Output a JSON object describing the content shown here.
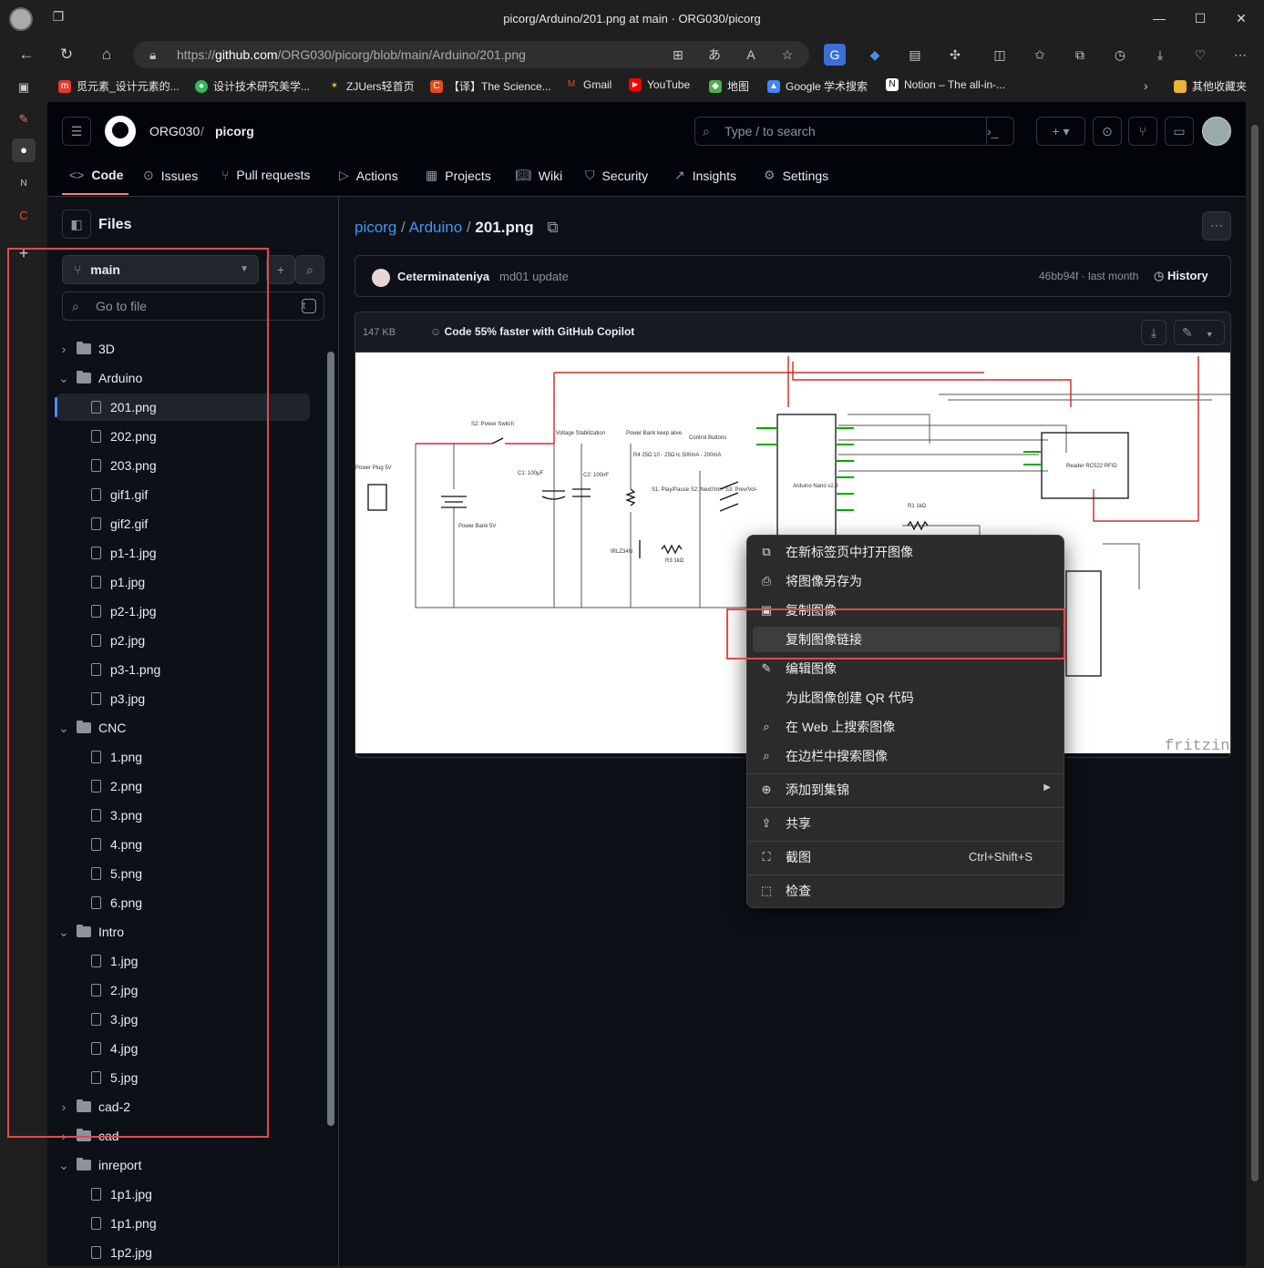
{
  "browser": {
    "window_title": "picorg/Arduino/201.png at main · ORG030/picorg",
    "url_prefix": "https://",
    "url_host": "github.com",
    "url_path": "/ORG030/picorg/blob/main/Arduino/201.png",
    "bookmarks": [
      "觅元素_设计元素的...",
      "设计技术研究美学...",
      "ZJUers轻首页",
      "【译】The Science...",
      "Gmail",
      "YouTube",
      "地图",
      "Google 学术搜索",
      "Notion – The all-in-...",
      "其他收藏夹"
    ]
  },
  "github": {
    "owner": "ORG030",
    "repo": "picorg",
    "search_placeholder": "Type / to search",
    "tabs": [
      "Code",
      "Issues",
      "Pull requests",
      "Actions",
      "Projects",
      "Wiki",
      "Security",
      "Insights",
      "Settings"
    ]
  },
  "files_panel": {
    "title": "Files",
    "branch": "main",
    "goto_placeholder": "Go to file",
    "goto_shortcut": "t",
    "tree": [
      {
        "name": "3D",
        "type": "folder",
        "open": false,
        "depth": 0
      },
      {
        "name": "Arduino",
        "type": "folder",
        "open": true,
        "depth": 0
      },
      {
        "name": "201.png",
        "type": "file",
        "depth": 1,
        "selected": true
      },
      {
        "name": "202.png",
        "type": "file",
        "depth": 1
      },
      {
        "name": "203.png",
        "type": "file",
        "depth": 1
      },
      {
        "name": "gif1.gif",
        "type": "file",
        "depth": 1
      },
      {
        "name": "gif2.gif",
        "type": "file",
        "depth": 1
      },
      {
        "name": "p1-1.jpg",
        "type": "file",
        "depth": 1
      },
      {
        "name": "p1.jpg",
        "type": "file",
        "depth": 1
      },
      {
        "name": "p2-1.jpg",
        "type": "file",
        "depth": 1
      },
      {
        "name": "p2.jpg",
        "type": "file",
        "depth": 1
      },
      {
        "name": "p3-1.png",
        "type": "file",
        "depth": 1
      },
      {
        "name": "p3.jpg",
        "type": "file",
        "depth": 1
      },
      {
        "name": "CNC",
        "type": "folder",
        "open": true,
        "depth": 0
      },
      {
        "name": "1.png",
        "type": "file",
        "depth": 1
      },
      {
        "name": "2.png",
        "type": "file",
        "depth": 1
      },
      {
        "name": "3.png",
        "type": "file",
        "depth": 1
      },
      {
        "name": "4.png",
        "type": "file",
        "depth": 1
      },
      {
        "name": "5.png",
        "type": "file",
        "depth": 1
      },
      {
        "name": "6.png",
        "type": "file",
        "depth": 1
      },
      {
        "name": "Intro",
        "type": "folder",
        "open": true,
        "depth": 0
      },
      {
        "name": "1.jpg",
        "type": "file",
        "depth": 1
      },
      {
        "name": "2.jpg",
        "type": "file",
        "depth": 1
      },
      {
        "name": "3.jpg",
        "type": "file",
        "depth": 1
      },
      {
        "name": "4.jpg",
        "type": "file",
        "depth": 1
      },
      {
        "name": "5.jpg",
        "type": "file",
        "depth": 1
      },
      {
        "name": "cad-2",
        "type": "folder",
        "open": false,
        "depth": 0
      },
      {
        "name": "cad",
        "type": "folder",
        "open": false,
        "depth": 0
      },
      {
        "name": "inreport",
        "type": "folder",
        "open": true,
        "depth": 0
      },
      {
        "name": "1p1.jpg",
        "type": "file",
        "depth": 1
      },
      {
        "name": "1p1.png",
        "type": "file",
        "depth": 1
      },
      {
        "name": "1p2.jpg",
        "type": "file",
        "depth": 1
      }
    ]
  },
  "file_view": {
    "breadcrumb_repo": "picorg",
    "breadcrumb_dir": "Arduino",
    "breadcrumb_file": "201.png",
    "commit_author": "Ceterminateniya",
    "commit_message": "md01 update",
    "commit_meta": "46bb94f · last month",
    "history_label": "History",
    "file_size": "147 KB",
    "copilot_text": "Code 55% faster with GitHub Copilot"
  },
  "schematic_labels": {
    "power_plug": "Power Plug 5V",
    "power_switch": "S2: Power Switch",
    "voltage": "Voltage Stabilization",
    "power_bank_keep": "Power Bank keep alive",
    "control_buttons": "Control Buttons",
    "c1": "C1: 100μF",
    "c2": "C2: 100nF",
    "r4": "R4 25Ω 10 - 25Ω Ic 500mA - 200mA",
    "buttons": "S1: Play/Pause S2: Next/Vol+ S3: Prev/Vol-",
    "power_bank": "Power Bank 5V",
    "transistor": "IRLZ34N",
    "r3": "R3 1kΩ",
    "r1": "R1 1kΩ",
    "arduino": "Arduino Nano v2.3",
    "reader": "Reader RC522 RFID",
    "watermark": "fritzing"
  },
  "context_menu": {
    "items": [
      {
        "label": "在新标签页中打开图像",
        "icon": "open-tab-icon"
      },
      {
        "label": "将图像另存为",
        "icon": "save-icon"
      },
      {
        "label": "复制图像",
        "icon": "copy-image-icon"
      },
      {
        "label": "复制图像链接",
        "icon": "link-icon",
        "highlighted": true
      },
      {
        "label": "编辑图像",
        "icon": "edit-icon"
      },
      {
        "label": "为此图像创建 QR 代码",
        "icon": "qr-icon"
      },
      {
        "label": "在 Web 上搜索图像",
        "icon": "search-web-icon"
      },
      {
        "label": "在边栏中搜索图像",
        "icon": "sidebar-search-icon"
      },
      {
        "label": "添加到集锦",
        "icon": "collections-icon"
      },
      {
        "label": "共享",
        "icon": "share-icon"
      },
      {
        "label": "截图",
        "icon": "screenshot-icon",
        "shortcut": "Ctrl+Shift+S"
      },
      {
        "label": "检查",
        "icon": "inspect-icon"
      }
    ]
  },
  "colors": {
    "accent_blue": "#4493f8",
    "highlight_red": "#e5484d",
    "gh_bg": "#0d1117",
    "tab_underline": "#f78166"
  }
}
